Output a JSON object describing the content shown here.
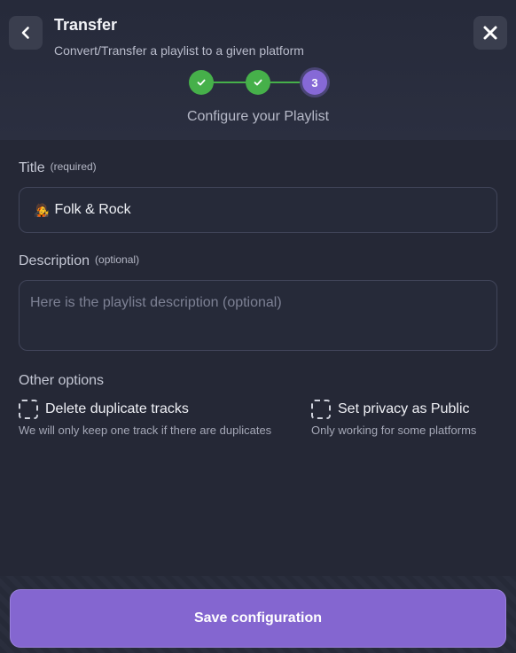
{
  "header": {
    "title": "Transfer",
    "subtitle": "Convert/Transfer a playlist to a given platform",
    "back_icon": "chevron-left-icon",
    "close_icon": "close-icon"
  },
  "stepper": {
    "steps": [
      {
        "state": "done",
        "icon": "check-icon"
      },
      {
        "state": "done",
        "icon": "check-icon"
      },
      {
        "state": "active",
        "number": "3"
      }
    ],
    "caption": "Configure your Playlist"
  },
  "form": {
    "title_label": "Title",
    "title_hint": "(required)",
    "title_emoji": "🧑‍🎤",
    "title_value": "Folk & Rock",
    "description_label": "Description",
    "description_hint": "(optional)",
    "description_placeholder": "Here is the playlist description (optional)"
  },
  "options": {
    "heading": "Other options",
    "items": [
      {
        "label": "Delete duplicate tracks",
        "description": "We will only keep one track if there are duplicates",
        "checked": false
      },
      {
        "label": "Set privacy as Public",
        "description": "Only working for some platforms",
        "checked": false
      }
    ]
  },
  "footer": {
    "save_label": "Save configuration"
  },
  "colors": {
    "background": "#252836",
    "accent": "#8466d0",
    "success": "#46b04a"
  }
}
